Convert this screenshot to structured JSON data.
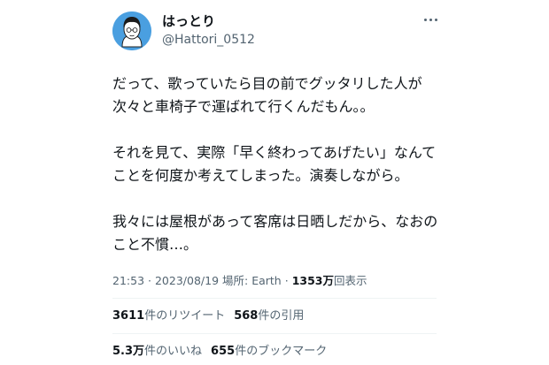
{
  "author": {
    "display_name": "はっとり",
    "handle": "@Hattori_0512"
  },
  "more_icon": "more-horizontal-icon",
  "tweet_lines": [
    "だって、歌っていたら目の前でグッタリした人が",
    "次々と車椅子で運ばれて行くんだもん。。",
    "",
    "それを見て、実際「早く終わってあげたい」なんて",
    "ことを何度か考えてしまった。演奏しながら。",
    "",
    "我々には屋根があって客席は日晒しだから、なおの",
    "こと不慣…。"
  ],
  "meta": {
    "time": "21:53",
    "date": "2023/08/19",
    "location_label": "場所: Earth",
    "views_count": "1353万",
    "views_label": "回表示",
    "separator": "·"
  },
  "stats": {
    "retweets_count": "3611",
    "retweets_label": "件のリツイート",
    "quotes_count": "568",
    "quotes_label": "件の引用",
    "likes_count": "5.3万",
    "likes_label": "件のいいね",
    "bookmarks_count": "655",
    "bookmarks_label": "件のブックマーク"
  },
  "colors": {
    "avatar_bg": "#4a9fe0",
    "text_primary": "#0f1419",
    "text_secondary": "#536471",
    "divider": "#eff3f4"
  }
}
